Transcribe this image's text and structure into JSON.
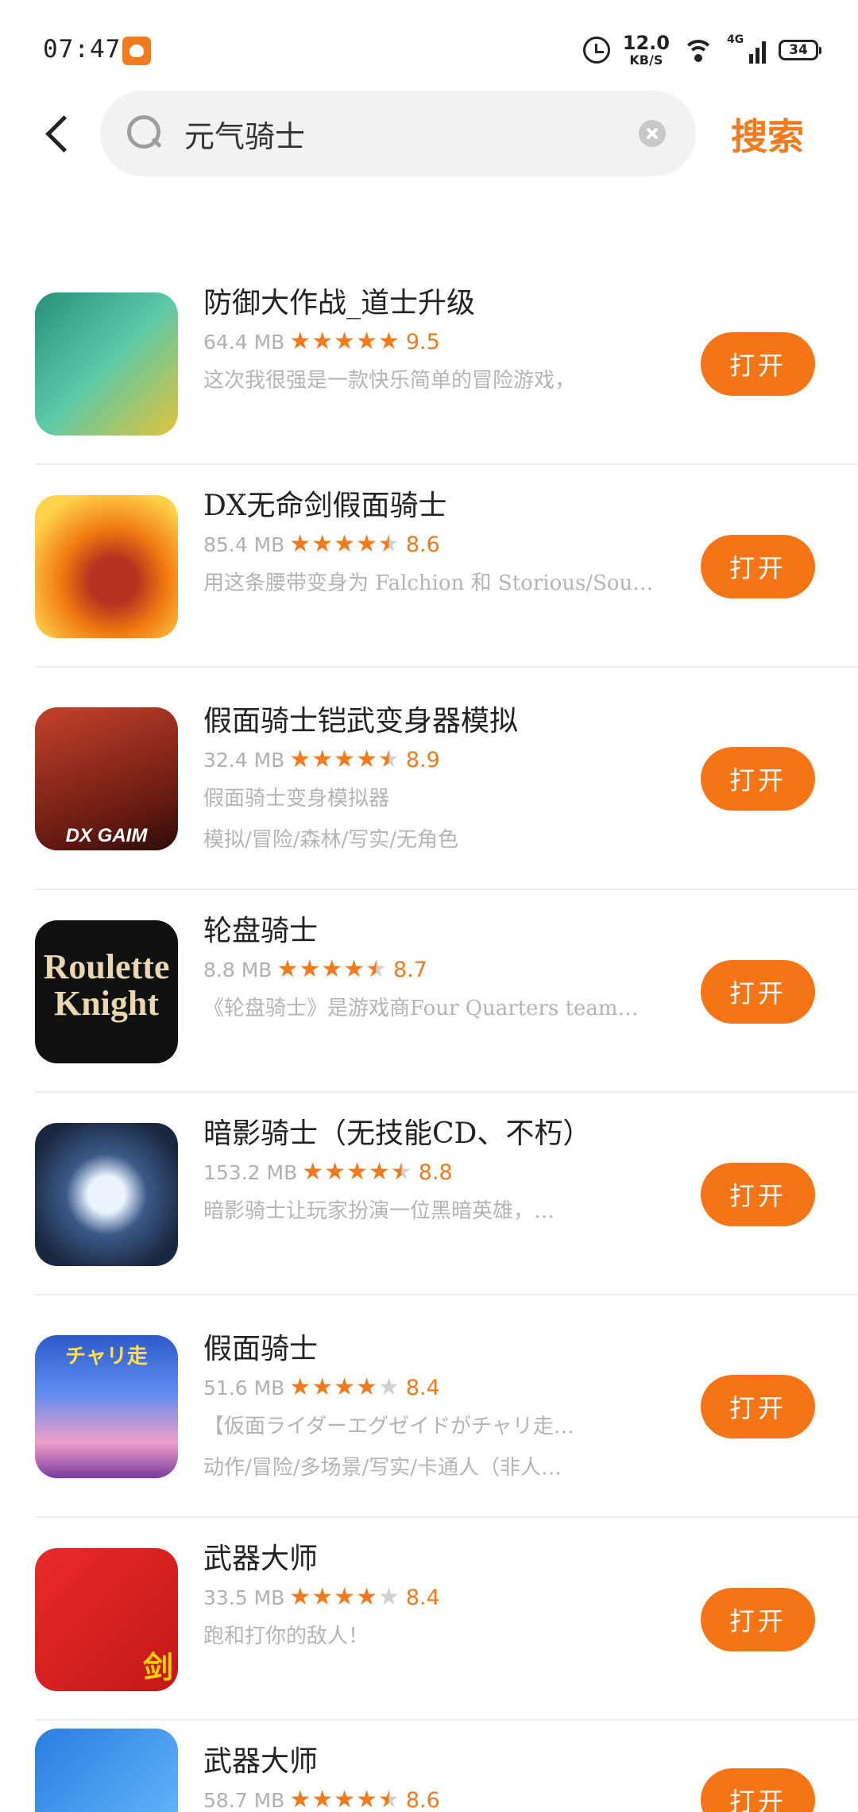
{
  "status_bar": {
    "time": "07:47",
    "net_speed": "12.0",
    "net_speed_unit": "KB/S",
    "network": "4G",
    "battery": "34"
  },
  "search": {
    "query": "元气骑士",
    "submit_label": "搜索"
  },
  "colors": {
    "accent": "#f57415",
    "star_empty": "#d0d0d0",
    "secondary_text": "#b4b4b4"
  },
  "results": [
    {
      "name": "防御大作战_道士升级",
      "size": "64.4 MB",
      "stars": 5,
      "rating": "9.5",
      "desc": "这次我很强是一款快乐简单的冒险游戏，",
      "button": "打开"
    },
    {
      "name": "DX无命剑假面骑士",
      "size": "85.4 MB",
      "stars": 4.5,
      "rating": "8.6",
      "desc": "用这条腰带变身为 Falchion 和 Storious/Sou…",
      "button": "打开"
    },
    {
      "name": "假面骑士铠武变身器模拟",
      "size": "32.4 MB",
      "stars": 4.5,
      "rating": "8.9",
      "desc": "假面骑士变身模拟器",
      "tags": "模拟/冒险/森林/写实/无角色",
      "icon_text": "DX GAIM",
      "button": "打开"
    },
    {
      "name": "轮盘骑士",
      "size": "8.8 MB",
      "stars": 4.5,
      "rating": "8.7",
      "desc": "《轮盘骑士》是游戏商Four Quarters team…",
      "icon_text": "Roulette Knight",
      "button": "打开"
    },
    {
      "name": "暗影骑士（无技能CD、不朽）",
      "size": "153.2 MB",
      "stars": 4.5,
      "rating": "8.8",
      "desc": "暗影骑士让玩家扮演一位黑暗英雄，…",
      "button": "打开"
    },
    {
      "name": "假面骑士",
      "size": "51.6 MB",
      "stars": 4,
      "rating": "8.4",
      "desc": "【仮面ライダーエグゼイドがチャリ走…",
      "tags": "动作/冒险/多场景/写实/卡通人（非人…",
      "icon_text": "チャリ走",
      "button": "打开"
    },
    {
      "name": "武器大师",
      "size": "33.5 MB",
      "stars": 4,
      "rating": "8.4",
      "desc": "跑和打你的敌人！",
      "icon_text": "剑",
      "button": "打开"
    },
    {
      "name": "武器大师",
      "size": "58.7 MB",
      "stars": 4.5,
      "rating": "8.6",
      "desc": "",
      "button": "打开"
    }
  ]
}
